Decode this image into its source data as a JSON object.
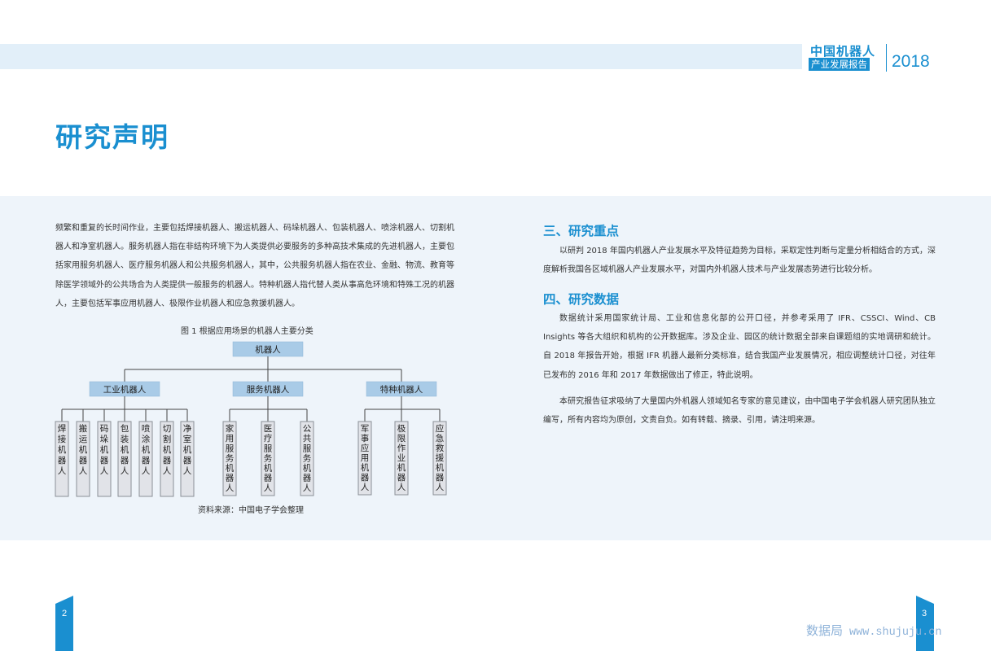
{
  "brand": {
    "name": "中国机器人",
    "subtitle": "产业发展报告",
    "year": "2018"
  },
  "page_title": "研究声明",
  "left_paragraph": "频繁和重复的长时间作业，主要包括焊接机器人、搬运机器人、码垛机器人、包装机器人、喷涂机器人、切割机器人和净室机器人。服务机器人指在非结构环境下为人类提供必要服务的多种高技术集成的先进机器人，主要包括家用服务机器人、医疗服务机器人和公共服务机器人，其中，公共服务机器人指在农业、金融、物流、教育等除医学领域外的公共场合为人类提供一般服务的机器人。特种机器人指代替人类从事高危环境和特殊工况的机器人，主要包括军事应用机器人、极限作业机器人和应急救援机器人。",
  "figure": {
    "caption": "图 1  根据应用场景的机器人主要分类",
    "source": "资料来源：中国电子学会整理",
    "root": "机器人",
    "groups": [
      {
        "label": "工业机器人",
        "leaves": [
          "焊接机器人",
          "搬运机器人",
          "码垛机器人",
          "包装机器人",
          "喷涂机器人",
          "切割机器人",
          "净室机器人"
        ]
      },
      {
        "label": "服务机器人",
        "leaves": [
          "家用服务机器人",
          "医疗服务机器人",
          "公共服务机器人"
        ]
      },
      {
        "label": "特种机器人",
        "leaves": [
          "军事应用机器人",
          "极限作业机器人",
          "应急救援机器人"
        ]
      }
    ],
    "colors": {
      "top_box": "#a9cbe7",
      "leaf_box": "#e1e3e8"
    }
  },
  "sections": [
    {
      "heading": "三、研究重点",
      "paragraphs": [
        "以研判 2018 年国内机器人产业发展水平及特征趋势为目标，采取定性判断与定量分析相结合的方式，深度解析我国各区域机器人产业发展水平，对国内外机器人技术与产业发展态势进行比较分析。"
      ]
    },
    {
      "heading": "四、研究数据",
      "paragraphs": [
        "数据统计采用国家统计局、工业和信息化部的公开口径，并参考采用了 IFR、CSSCI、Wind、CB Insights 等各大组织和机构的公开数据库。涉及企业、园区的统计数据全部来自课题组的实地调研和统计。自 2018 年报告开始，根据 IFR 机器人最新分类标准，结合我国产业发展情况，相应调整统计口径，对往年已发布的 2016 年和 2017 年数据做出了修正，特此说明。",
        "本研究报告征求吸纳了大量国内外机器人领域知名专家的意见建议，由中国电子学会机器人研究团队独立编写，所有内容均为原创，文责自负。如有转载、摘录、引用，请注明来源。"
      ]
    }
  ],
  "page_numbers": {
    "left": "2",
    "right": "3"
  },
  "watermark": {
    "text": "数据局",
    "url": "www.shujuju.cn"
  },
  "accent_color": "#1a8fd0"
}
